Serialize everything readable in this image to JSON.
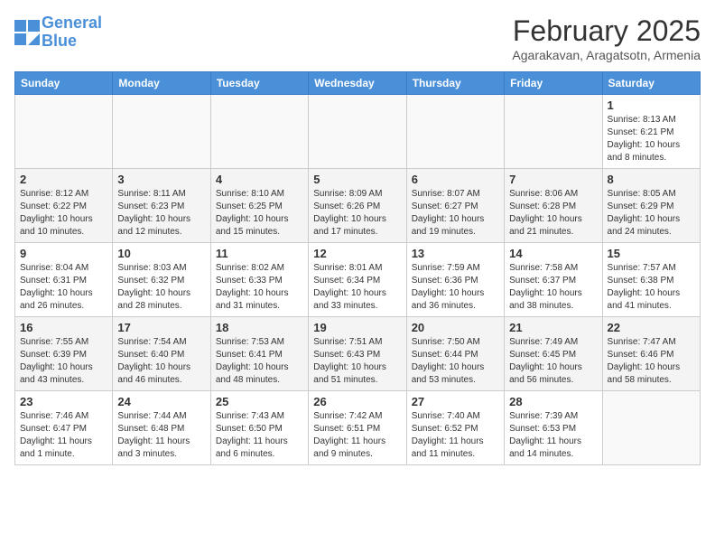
{
  "header": {
    "logo_line1": "General",
    "logo_line2": "Blue",
    "month": "February 2025",
    "location": "Agarakavan, Aragatsotn, Armenia"
  },
  "weekdays": [
    "Sunday",
    "Monday",
    "Tuesday",
    "Wednesday",
    "Thursday",
    "Friday",
    "Saturday"
  ],
  "weeks": [
    [
      {
        "day": "",
        "info": ""
      },
      {
        "day": "",
        "info": ""
      },
      {
        "day": "",
        "info": ""
      },
      {
        "day": "",
        "info": ""
      },
      {
        "day": "",
        "info": ""
      },
      {
        "day": "",
        "info": ""
      },
      {
        "day": "1",
        "info": "Sunrise: 8:13 AM\nSunset: 6:21 PM\nDaylight: 10 hours\nand 8 minutes."
      }
    ],
    [
      {
        "day": "2",
        "info": "Sunrise: 8:12 AM\nSunset: 6:22 PM\nDaylight: 10 hours\nand 10 minutes."
      },
      {
        "day": "3",
        "info": "Sunrise: 8:11 AM\nSunset: 6:23 PM\nDaylight: 10 hours\nand 12 minutes."
      },
      {
        "day": "4",
        "info": "Sunrise: 8:10 AM\nSunset: 6:25 PM\nDaylight: 10 hours\nand 15 minutes."
      },
      {
        "day": "5",
        "info": "Sunrise: 8:09 AM\nSunset: 6:26 PM\nDaylight: 10 hours\nand 17 minutes."
      },
      {
        "day": "6",
        "info": "Sunrise: 8:07 AM\nSunset: 6:27 PM\nDaylight: 10 hours\nand 19 minutes."
      },
      {
        "day": "7",
        "info": "Sunrise: 8:06 AM\nSunset: 6:28 PM\nDaylight: 10 hours\nand 21 minutes."
      },
      {
        "day": "8",
        "info": "Sunrise: 8:05 AM\nSunset: 6:29 PM\nDaylight: 10 hours\nand 24 minutes."
      }
    ],
    [
      {
        "day": "9",
        "info": "Sunrise: 8:04 AM\nSunset: 6:31 PM\nDaylight: 10 hours\nand 26 minutes."
      },
      {
        "day": "10",
        "info": "Sunrise: 8:03 AM\nSunset: 6:32 PM\nDaylight: 10 hours\nand 28 minutes."
      },
      {
        "day": "11",
        "info": "Sunrise: 8:02 AM\nSunset: 6:33 PM\nDaylight: 10 hours\nand 31 minutes."
      },
      {
        "day": "12",
        "info": "Sunrise: 8:01 AM\nSunset: 6:34 PM\nDaylight: 10 hours\nand 33 minutes."
      },
      {
        "day": "13",
        "info": "Sunrise: 7:59 AM\nSunset: 6:36 PM\nDaylight: 10 hours\nand 36 minutes."
      },
      {
        "day": "14",
        "info": "Sunrise: 7:58 AM\nSunset: 6:37 PM\nDaylight: 10 hours\nand 38 minutes."
      },
      {
        "day": "15",
        "info": "Sunrise: 7:57 AM\nSunset: 6:38 PM\nDaylight: 10 hours\nand 41 minutes."
      }
    ],
    [
      {
        "day": "16",
        "info": "Sunrise: 7:55 AM\nSunset: 6:39 PM\nDaylight: 10 hours\nand 43 minutes."
      },
      {
        "day": "17",
        "info": "Sunrise: 7:54 AM\nSunset: 6:40 PM\nDaylight: 10 hours\nand 46 minutes."
      },
      {
        "day": "18",
        "info": "Sunrise: 7:53 AM\nSunset: 6:41 PM\nDaylight: 10 hours\nand 48 minutes."
      },
      {
        "day": "19",
        "info": "Sunrise: 7:51 AM\nSunset: 6:43 PM\nDaylight: 10 hours\nand 51 minutes."
      },
      {
        "day": "20",
        "info": "Sunrise: 7:50 AM\nSunset: 6:44 PM\nDaylight: 10 hours\nand 53 minutes."
      },
      {
        "day": "21",
        "info": "Sunrise: 7:49 AM\nSunset: 6:45 PM\nDaylight: 10 hours\nand 56 minutes."
      },
      {
        "day": "22",
        "info": "Sunrise: 7:47 AM\nSunset: 6:46 PM\nDaylight: 10 hours\nand 58 minutes."
      }
    ],
    [
      {
        "day": "23",
        "info": "Sunrise: 7:46 AM\nSunset: 6:47 PM\nDaylight: 11 hours\nand 1 minute."
      },
      {
        "day": "24",
        "info": "Sunrise: 7:44 AM\nSunset: 6:48 PM\nDaylight: 11 hours\nand 3 minutes."
      },
      {
        "day": "25",
        "info": "Sunrise: 7:43 AM\nSunset: 6:50 PM\nDaylight: 11 hours\nand 6 minutes."
      },
      {
        "day": "26",
        "info": "Sunrise: 7:42 AM\nSunset: 6:51 PM\nDaylight: 11 hours\nand 9 minutes."
      },
      {
        "day": "27",
        "info": "Sunrise: 7:40 AM\nSunset: 6:52 PM\nDaylight: 11 hours\nand 11 minutes."
      },
      {
        "day": "28",
        "info": "Sunrise: 7:39 AM\nSunset: 6:53 PM\nDaylight: 11 hours\nand 14 minutes."
      },
      {
        "day": "",
        "info": ""
      }
    ]
  ]
}
